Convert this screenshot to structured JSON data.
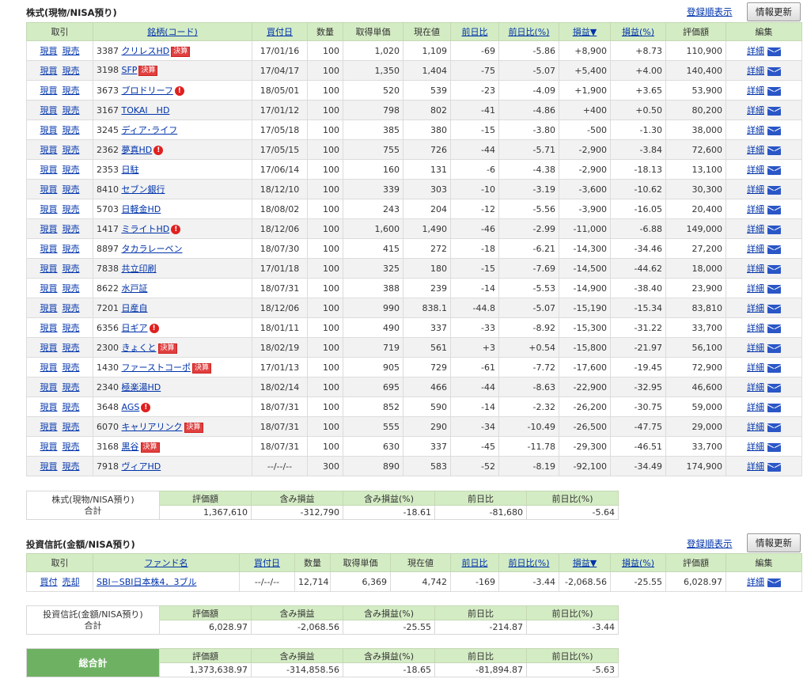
{
  "stocks": {
    "title": "株式(現物/NISA預り)",
    "sort_label": "登録順表示",
    "refresh_label": "情報更新",
    "headers": [
      "取引",
      "銘柄(コード)",
      "買付日",
      "数量",
      "取得単価",
      "現在値",
      "前日比",
      "前日比(%)",
      "損益▼",
      "損益(%)",
      "評価額",
      "編集"
    ],
    "buy_label": "現買",
    "sell_label": "現売",
    "detail_label": "詳細",
    "rows": [
      {
        "code": "3387",
        "name": "クリレスHD",
        "badge": "決算",
        "alert": false,
        "date": "17/01/16",
        "qty": "100",
        "cost": "1,020",
        "price": "1,109",
        "chg": "-69",
        "chg_pct": "-5.86",
        "pl": "+8,900",
        "pl_pct": "+8.73",
        "value": "110,900"
      },
      {
        "code": "3198",
        "name": "SFP",
        "badge": "決算",
        "alert": false,
        "date": "17/04/17",
        "qty": "100",
        "cost": "1,350",
        "price": "1,404",
        "chg": "-75",
        "chg_pct": "-5.07",
        "pl": "+5,400",
        "pl_pct": "+4.00",
        "value": "140,400"
      },
      {
        "code": "3673",
        "name": "ブロドリーフ",
        "badge": "",
        "alert": true,
        "date": "18/05/01",
        "qty": "100",
        "cost": "520",
        "price": "539",
        "chg": "-23",
        "chg_pct": "-4.09",
        "pl": "+1,900",
        "pl_pct": "+3.65",
        "value": "53,900"
      },
      {
        "code": "3167",
        "name": "TOKAI　HD",
        "badge": "",
        "alert": false,
        "date": "17/01/12",
        "qty": "100",
        "cost": "798",
        "price": "802",
        "chg": "-41",
        "chg_pct": "-4.86",
        "pl": "+400",
        "pl_pct": "+0.50",
        "value": "80,200"
      },
      {
        "code": "3245",
        "name": "ディア･ライフ",
        "badge": "",
        "alert": false,
        "date": "17/05/18",
        "qty": "100",
        "cost": "385",
        "price": "380",
        "chg": "-15",
        "chg_pct": "-3.80",
        "pl": "-500",
        "pl_pct": "-1.30",
        "value": "38,000"
      },
      {
        "code": "2362",
        "name": "夢真HD",
        "badge": "",
        "alert": true,
        "date": "17/05/15",
        "qty": "100",
        "cost": "755",
        "price": "726",
        "chg": "-44",
        "chg_pct": "-5.71",
        "pl": "-2,900",
        "pl_pct": "-3.84",
        "value": "72,600"
      },
      {
        "code": "2353",
        "name": "日駐",
        "badge": "",
        "alert": false,
        "date": "17/06/14",
        "qty": "100",
        "cost": "160",
        "price": "131",
        "chg": "-6",
        "chg_pct": "-4.38",
        "pl": "-2,900",
        "pl_pct": "-18.13",
        "value": "13,100"
      },
      {
        "code": "8410",
        "name": "セブン銀行",
        "badge": "",
        "alert": false,
        "date": "18/12/10",
        "qty": "100",
        "cost": "339",
        "price": "303",
        "chg": "-10",
        "chg_pct": "-3.19",
        "pl": "-3,600",
        "pl_pct": "-10.62",
        "value": "30,300"
      },
      {
        "code": "5703",
        "name": "日軽金HD",
        "badge": "",
        "alert": false,
        "date": "18/08/02",
        "qty": "100",
        "cost": "243",
        "price": "204",
        "chg": "-12",
        "chg_pct": "-5.56",
        "pl": "-3,900",
        "pl_pct": "-16.05",
        "value": "20,400"
      },
      {
        "code": "1417",
        "name": "ミライトHD",
        "badge": "",
        "alert": true,
        "date": "18/12/06",
        "qty": "100",
        "cost": "1,600",
        "price": "1,490",
        "chg": "-46",
        "chg_pct": "-2.99",
        "pl": "-11,000",
        "pl_pct": "-6.88",
        "value": "149,000"
      },
      {
        "code": "8897",
        "name": "タカラレーベン",
        "badge": "",
        "alert": false,
        "date": "18/07/30",
        "qty": "100",
        "cost": "415",
        "price": "272",
        "chg": "-18",
        "chg_pct": "-6.21",
        "pl": "-14,300",
        "pl_pct": "-34.46",
        "value": "27,200"
      },
      {
        "code": "7838",
        "name": "共立印刷",
        "badge": "",
        "alert": false,
        "date": "17/01/18",
        "qty": "100",
        "cost": "325",
        "price": "180",
        "chg": "-15",
        "chg_pct": "-7.69",
        "pl": "-14,500",
        "pl_pct": "-44.62",
        "value": "18,000"
      },
      {
        "code": "8622",
        "name": "水戸証",
        "badge": "",
        "alert": false,
        "date": "18/07/31",
        "qty": "100",
        "cost": "388",
        "price": "239",
        "chg": "-14",
        "chg_pct": "-5.53",
        "pl": "-14,900",
        "pl_pct": "-38.40",
        "value": "23,900"
      },
      {
        "code": "7201",
        "name": "日産自",
        "badge": "",
        "alert": false,
        "date": "18/12/06",
        "qty": "100",
        "cost": "990",
        "price": "838.1",
        "chg": "-44.8",
        "chg_pct": "-5.07",
        "pl": "-15,190",
        "pl_pct": "-15.34",
        "value": "83,810"
      },
      {
        "code": "6356",
        "name": "日ギア",
        "badge": "",
        "alert": true,
        "date": "18/01/11",
        "qty": "100",
        "cost": "490",
        "price": "337",
        "chg": "-33",
        "chg_pct": "-8.92",
        "pl": "-15,300",
        "pl_pct": "-31.22",
        "value": "33,700"
      },
      {
        "code": "2300",
        "name": "きょくと",
        "badge": "決算",
        "alert": false,
        "date": "18/02/19",
        "qty": "100",
        "cost": "719",
        "price": "561",
        "chg": "+3",
        "chg_pct": "+0.54",
        "pl": "-15,800",
        "pl_pct": "-21.97",
        "value": "56,100"
      },
      {
        "code": "1430",
        "name": "ファーストコーポ",
        "badge": "決算",
        "alert": false,
        "date": "17/01/13",
        "qty": "100",
        "cost": "905",
        "price": "729",
        "chg": "-61",
        "chg_pct": "-7.72",
        "pl": "-17,600",
        "pl_pct": "-19.45",
        "value": "72,900"
      },
      {
        "code": "2340",
        "name": "極楽湯HD",
        "badge": "",
        "alert": false,
        "date": "18/02/14",
        "qty": "100",
        "cost": "695",
        "price": "466",
        "chg": "-44",
        "chg_pct": "-8.63",
        "pl": "-22,900",
        "pl_pct": "-32.95",
        "value": "46,600"
      },
      {
        "code": "3648",
        "name": "AGS",
        "badge": "",
        "alert": true,
        "date": "18/07/31",
        "qty": "100",
        "cost": "852",
        "price": "590",
        "chg": "-14",
        "chg_pct": "-2.32",
        "pl": "-26,200",
        "pl_pct": "-30.75",
        "value": "59,000"
      },
      {
        "code": "6070",
        "name": "キャリアリンク",
        "badge": "決算",
        "alert": false,
        "date": "18/07/31",
        "qty": "100",
        "cost": "555",
        "price": "290",
        "chg": "-34",
        "chg_pct": "-10.49",
        "pl": "-26,500",
        "pl_pct": "-47.75",
        "value": "29,000"
      },
      {
        "code": "3168",
        "name": "黒谷",
        "badge": "決算",
        "alert": false,
        "date": "18/07/31",
        "qty": "100",
        "cost": "630",
        "price": "337",
        "chg": "-45",
        "chg_pct": "-11.78",
        "pl": "-29,300",
        "pl_pct": "-46.51",
        "value": "33,700"
      },
      {
        "code": "7918",
        "name": "ヴィアHD",
        "badge": "",
        "alert": false,
        "date": "--/--/--",
        "qty": "300",
        "cost": "890",
        "price": "583",
        "chg": "-52",
        "chg_pct": "-8.19",
        "pl": "-92,100",
        "pl_pct": "-34.49",
        "value": "174,900"
      }
    ],
    "summary": {
      "label_line1": "株式(現物/NISA預り)",
      "label_line2": "合計",
      "headers": [
        "評価額",
        "含み損益",
        "含み損益(%)",
        "前日比",
        "前日比(%)"
      ],
      "values": [
        "1,367,610",
        "-312,790",
        "-18.61",
        "-81,680",
        "-5.64"
      ]
    }
  },
  "funds": {
    "title": "投資信託(金額/NISA預り)",
    "sort_label": "登録順表示",
    "refresh_label": "情報更新",
    "headers": [
      "取引",
      "ファンド名",
      "買付日",
      "数量",
      "取得単価",
      "現在値",
      "前日比",
      "前日比(%)",
      "損益▼",
      "損益(%)",
      "評価額",
      "編集"
    ],
    "buy_label": "買付",
    "sell_label": "売却",
    "detail_label": "詳細",
    "rows": [
      {
        "name": "SBI－SBI日本株4．3ブル",
        "date": "--/--/--",
        "qty": "12,714",
        "cost": "6,369",
        "price": "4,742",
        "chg": "-169",
        "chg_pct": "-3.44",
        "pl": "-2,068.56",
        "pl_pct": "-25.55",
        "value": "6,028.97"
      }
    ],
    "summary": {
      "label_line1": "投資信託(金額/NISA預り)",
      "label_line2": "合計",
      "headers": [
        "評価額",
        "含み損益",
        "含み損益(%)",
        "前日比",
        "前日比(%)"
      ],
      "values": [
        "6,028.97",
        "-2,068.56",
        "-25.55",
        "-214.87",
        "-3.44"
      ]
    }
  },
  "grand_total": {
    "label": "総合計",
    "headers": [
      "評価額",
      "含み損益",
      "含み損益(%)",
      "前日比",
      "前日比(%)"
    ],
    "values": [
      "1,373,638.97",
      "-314,858.56",
      "-18.65",
      "-81,894.87",
      "-5.63"
    ]
  },
  "colors": {
    "header_green": "#d4ecc4",
    "total_green": "#6fb163",
    "negative": "#1d39c4",
    "positive": "#e00000",
    "link": "#0033aa"
  }
}
